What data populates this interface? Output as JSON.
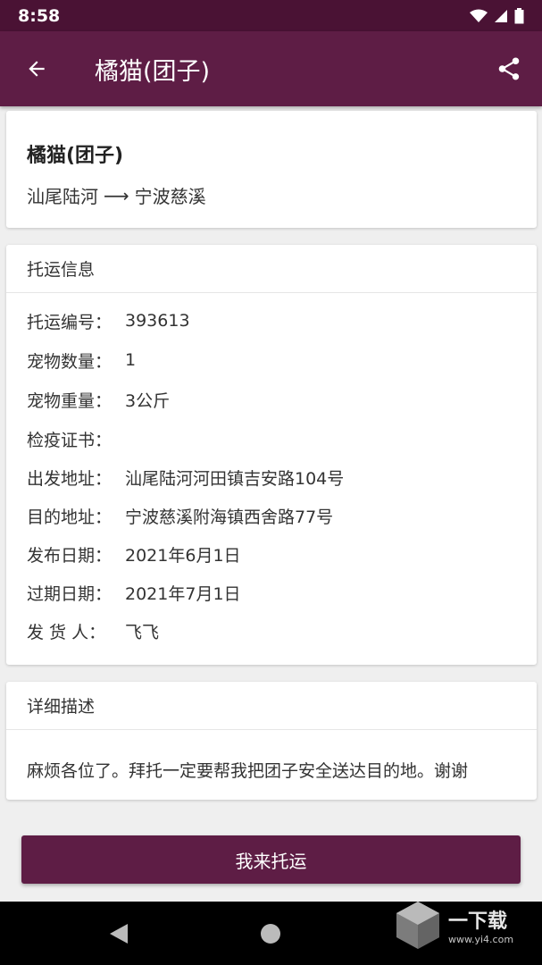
{
  "status_bar": {
    "time": "8:58"
  },
  "app_bar": {
    "title": "橘猫(团子)",
    "back_icon": "arrow-back-icon",
    "share_icon": "share-icon"
  },
  "summary": {
    "name": "橘猫(团子)",
    "from": "汕尾陆河",
    "arrow": "⟶",
    "to": "宁波慈溪"
  },
  "shipping_info": {
    "heading": "托运信息",
    "rows": [
      {
        "label": "托运编号：",
        "value": "393613"
      },
      {
        "label": "宠物数量：",
        "value": "1"
      },
      {
        "label": "宠物重量：",
        "value": "3公斤"
      },
      {
        "label": "检疫证书：",
        "value": ""
      },
      {
        "label": "出发地址：",
        "value": "汕尾陆河河田镇吉安路104号"
      },
      {
        "label": "目的地址：",
        "value": "宁波慈溪附海镇西舍路77号"
      },
      {
        "label": "发布日期：",
        "value": "2021年6月1日"
      },
      {
        "label": "过期日期：",
        "value": "2021年7月1日"
      },
      {
        "label": "发 货 人：",
        "value": "飞飞"
      }
    ]
  },
  "description": {
    "heading": "详细描述",
    "text": "麻烦各位了。拜托一定要帮我把团子安全送达目的地。谢谢"
  },
  "action": {
    "label": "我来托运"
  },
  "watermark": {
    "brand": "一下载",
    "url": "www.yi4.com"
  },
  "colors": {
    "primary": "#5e1d45",
    "status_bar": "#4a1234",
    "background": "#efefef"
  }
}
